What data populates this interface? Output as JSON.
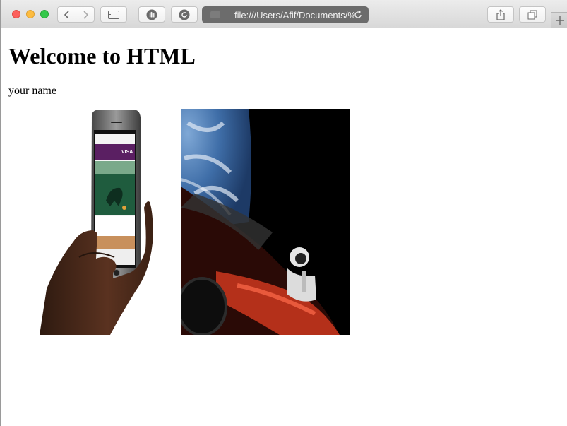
{
  "browser": {
    "address_url": "file:///Users/Afif/Documents/%",
    "new_tab_label": "+"
  },
  "page": {
    "heading": "Welcome to HTML",
    "paragraph": "your name"
  },
  "images": [
    {
      "name": "hand holding smartphone",
      "visa": "VISA"
    },
    {
      "name": "roadster in space above earth"
    }
  ],
  "colors": {
    "close": "#fc605c",
    "minimize": "#fdbc40",
    "zoom": "#34c84a",
    "address_bg": "#6c6c6c"
  }
}
